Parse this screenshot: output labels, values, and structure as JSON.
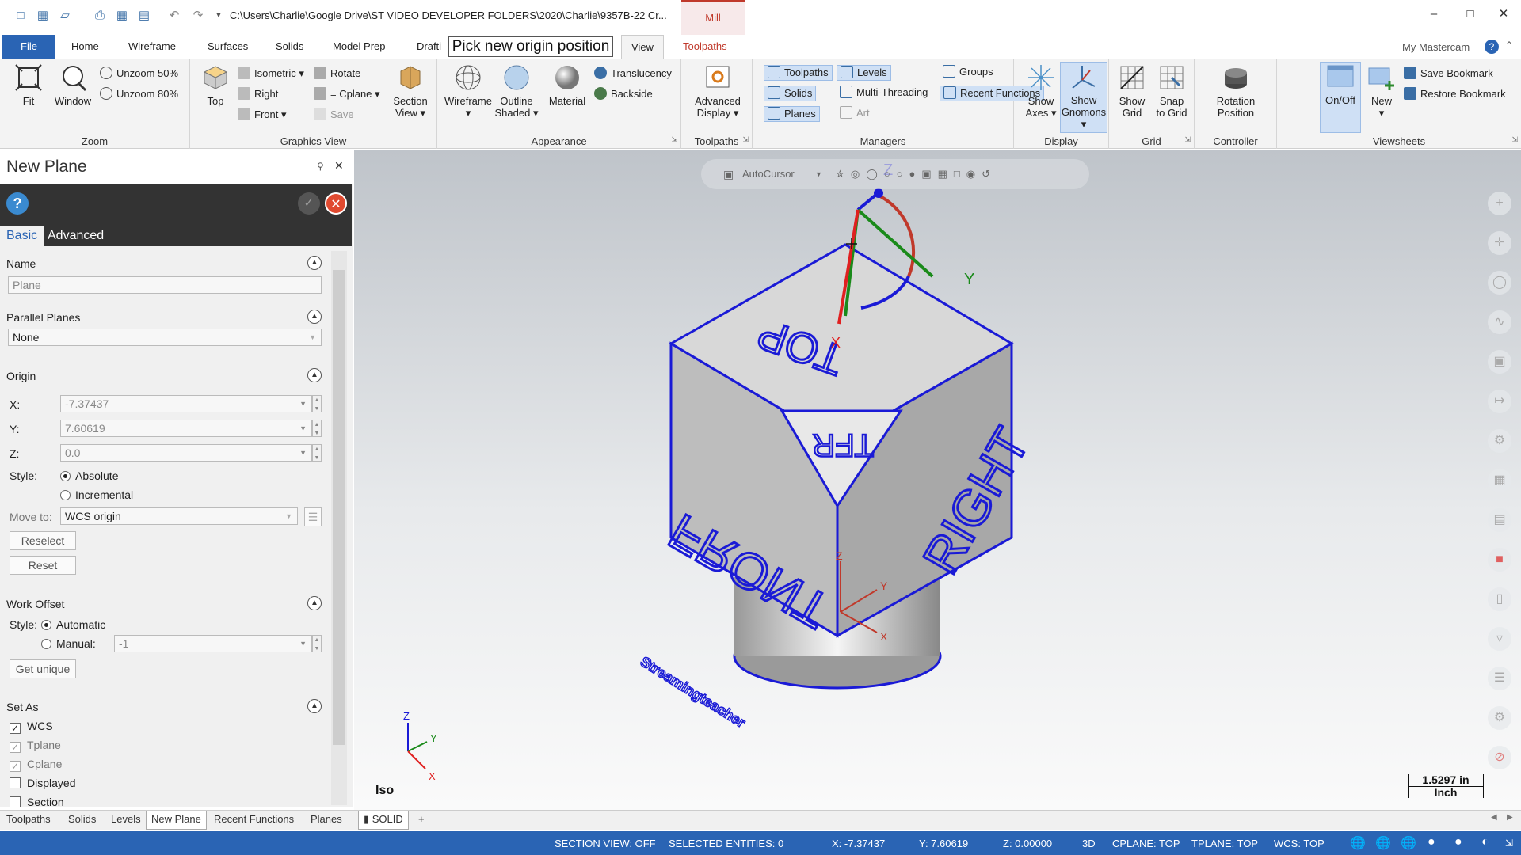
{
  "title_bar": {
    "path": "C:\\Users\\Charlie\\Google Drive\\ST VIDEO DEVELOPER FOLDERS\\2020\\Charlie\\9357B-22 Cr...",
    "context_tab": "Mill"
  },
  "ribbon_tabs": [
    "File",
    "Home",
    "Wireframe",
    "Surfaces",
    "Solids",
    "Model Prep",
    "Drafti",
    "View",
    "Toolpaths"
  ],
  "tooltip": "Pick new origin position",
  "my_mastercam": "My Mastercam",
  "ribbon": {
    "zoom": {
      "label": "Zoom",
      "fit": "Fit",
      "window": "Window",
      "unzoom50": "Unzoom 50%",
      "unzoom80": "Unzoom 80%"
    },
    "graphics_view": {
      "label": "Graphics View",
      "top": "Top",
      "isometric": "Isometric",
      "right": "Right",
      "front": "Front",
      "rotate": "Rotate",
      "cplane": "= Cplane",
      "save": "Save",
      "section_view_1": "Section",
      "section_view_2": "View"
    },
    "appearance": {
      "label": "Appearance",
      "wireframe": "Wireframe",
      "outline_1": "Outline",
      "outline_2": "Shaded",
      "material": "Material",
      "translucency": "Translucency",
      "backside": "Backside"
    },
    "toolpaths": {
      "label": "Toolpaths",
      "advanced_1": "Advanced",
      "advanced_2": "Display"
    },
    "managers": {
      "label": "Managers",
      "toolpaths": "Toolpaths",
      "solids": "Solids",
      "planes": "Planes",
      "levels": "Levels",
      "multi_threading": "Multi-Threading",
      "art": "Art",
      "groups": "Groups",
      "recent_functions": "Recent Functions"
    },
    "display": {
      "label": "Display",
      "show_axes_1": "Show",
      "show_axes_2": "Axes",
      "show_gnomons_1": "Show",
      "show_gnomons_2": "Gnomons"
    },
    "grid": {
      "label": "Grid",
      "show_grid_1": "Show",
      "show_grid_2": "Grid",
      "snap_1": "Snap",
      "snap_2": "to Grid"
    },
    "controller": {
      "label": "Controller",
      "rotation_1": "Rotation",
      "rotation_2": "Position"
    },
    "viewsheets": {
      "label": "Viewsheets",
      "onoff": "On/Off",
      "new": "New",
      "save_bookmark": "Save Bookmark",
      "restore_bookmark": "Restore Bookmark"
    }
  },
  "panel": {
    "title": "New Plane",
    "tabs": [
      "Basic",
      "Advanced"
    ],
    "name_section": "Name",
    "name_value": "Plane",
    "parallel_section": "Parallel Planes",
    "parallel_value": "None",
    "origin_section": "Origin",
    "x_label": "X:",
    "x_value": "-7.37437",
    "y_label": "Y:",
    "y_value": "7.60619",
    "z_label": "Z:",
    "z_value": "0.0",
    "style_label": "Style:",
    "absolute": "Absolute",
    "incremental": "Incremental",
    "move_to_label": "Move to:",
    "move_to_value": "WCS origin",
    "reselect": "Reselect",
    "reset": "Reset",
    "work_offset_section": "Work Offset",
    "wo_style_label": "Style:",
    "automatic": "Automatic",
    "manual": "Manual:",
    "manual_value": "-1",
    "get_unique": "Get unique",
    "set_as_section": "Set As",
    "set_as": [
      {
        "label": "WCS",
        "checked": true
      },
      {
        "label": "Tplane",
        "checked": true
      },
      {
        "label": "Cplane",
        "checked": true
      },
      {
        "label": "Displayed",
        "checked": false
      },
      {
        "label": "Section",
        "checked": false
      }
    ]
  },
  "bottom_tabs": [
    "Toolpaths",
    "Solids",
    "Levels",
    "New Plane",
    "Recent Functions",
    "Planes"
  ],
  "active_bottom_tab": "New Plane",
  "viewsheet_tab": "SOLID",
  "viewport": {
    "autocursor": "AutoCursor",
    "view_name": "Iso",
    "scale_1": "1.5297 in",
    "scale_2": "Inch",
    "cube": {
      "top": "TOP",
      "front": "FRONT",
      "right": "RIGHT",
      "tfr": "TFR"
    },
    "watermark": "Streamingteacher",
    "axes": {
      "x": "X",
      "y": "Y",
      "z": "Z"
    }
  },
  "status": {
    "section_view": "SECTION VIEW: OFF",
    "selected": "SELECTED ENTITIES: 0",
    "x": "X:  -7.37437",
    "y": "Y:  7.60619",
    "z": "Z:  0.00000",
    "mode": "3D",
    "cplane": "CPLANE: TOP",
    "tplane": "TPLANE: TOP",
    "wcs": "WCS: TOP"
  },
  "colors": {
    "accent": "#2a64b4",
    "mill": "#c0392b",
    "cube_edge": "#1a1ad6"
  }
}
